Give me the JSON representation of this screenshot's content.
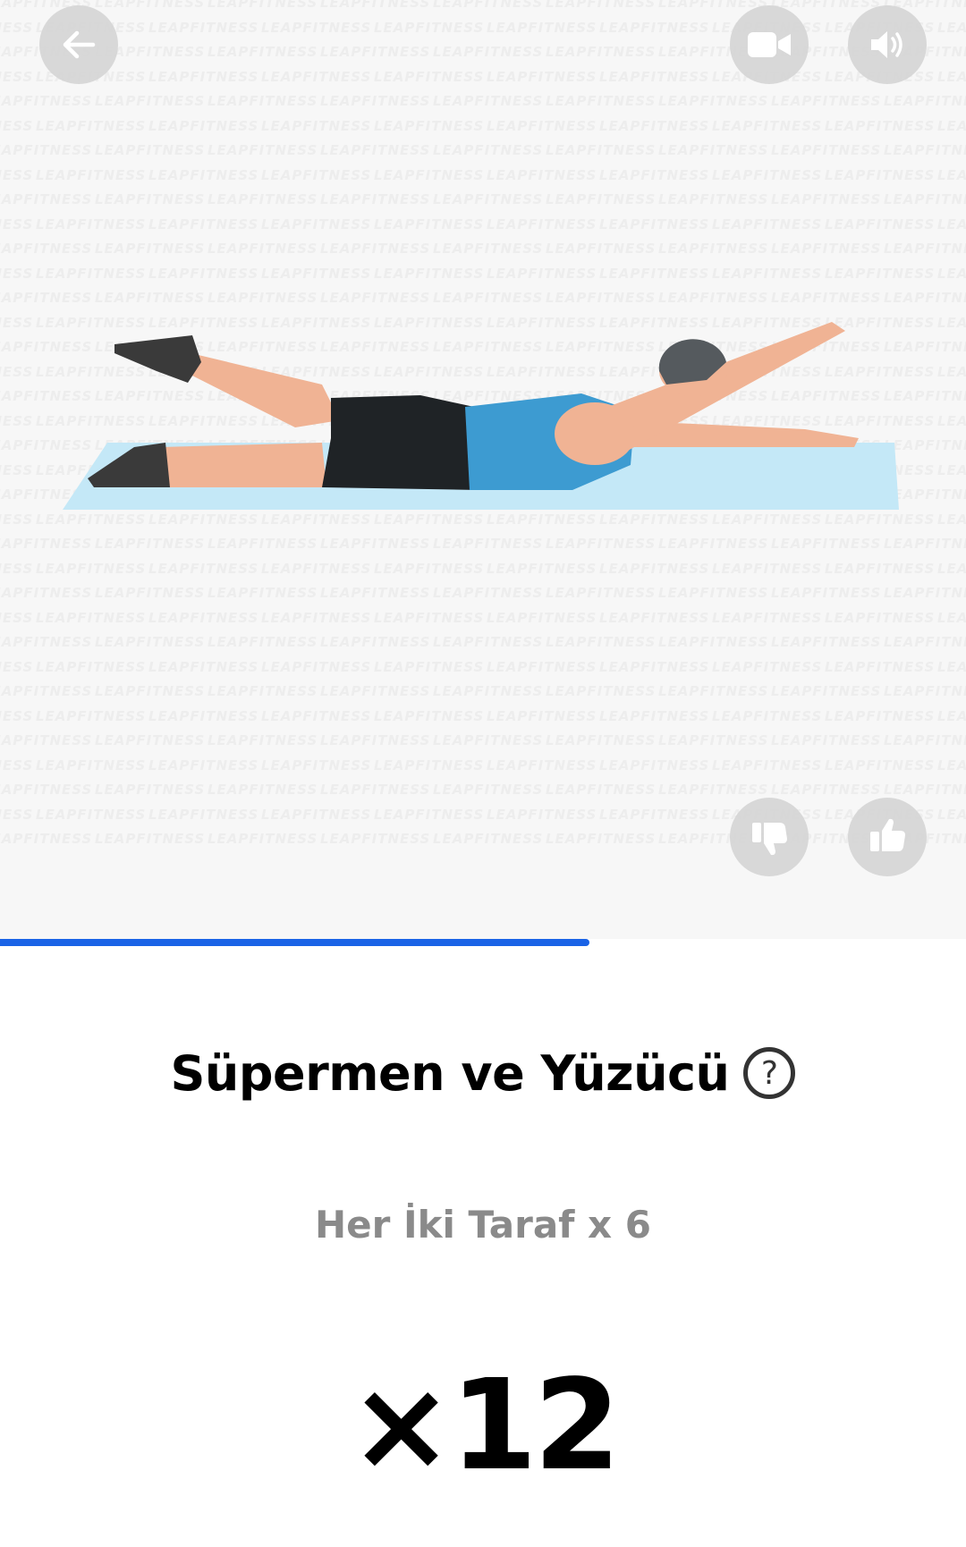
{
  "exercise": {
    "title": "Süpermen ve Yüzücü",
    "detail": "Her İki Taraf x 6",
    "count": "×12",
    "progress_fraction": 0.61
  },
  "watermark_text": "LEAPFITNESS",
  "icons": {
    "back": "arrow-left-icon",
    "video": "video-camera-icon",
    "sound": "speaker-volume-icon",
    "dislike": "thumbs-down-icon",
    "like": "thumbs-up-icon",
    "help": "question-mark-circle-icon"
  },
  "colors": {
    "progress": "#1a63e6",
    "shirt": "#3d9bd1",
    "mat": "#bfe6f7",
    "skin": "#f0b394"
  }
}
